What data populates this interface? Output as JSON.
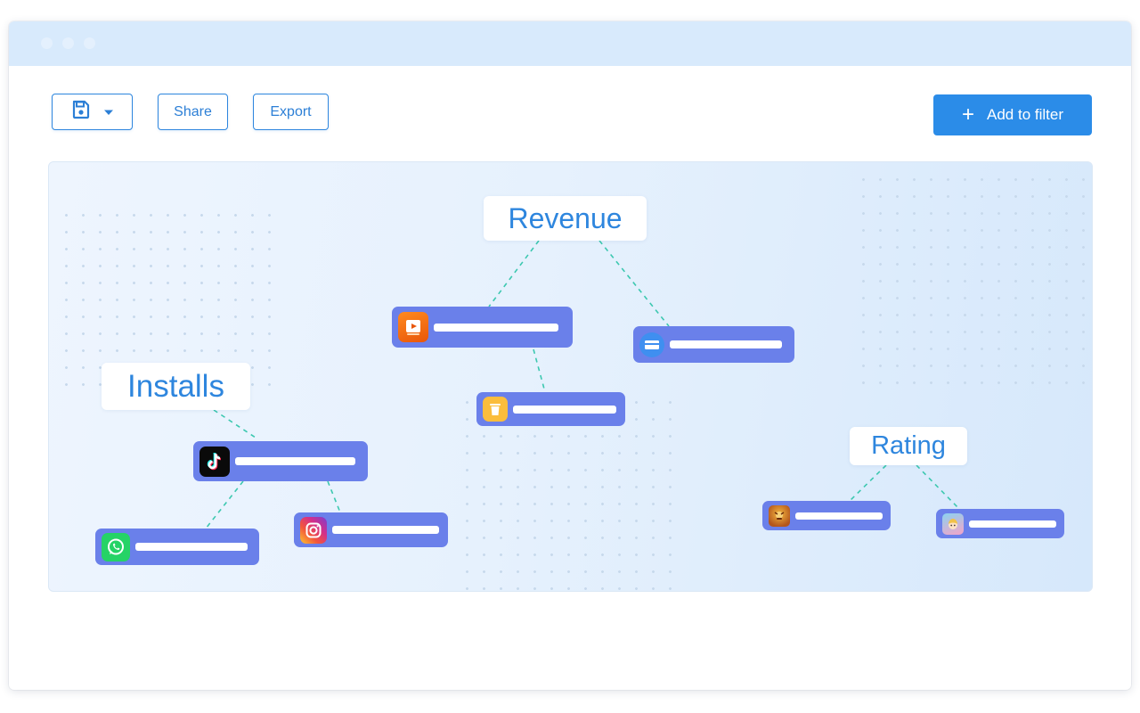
{
  "toolbar": {
    "save_icon": "floppy-disk-icon",
    "dropdown_icon": "caret-down-icon",
    "share_label": "Share",
    "export_label": "Export",
    "add_filter_label": "Add to filter",
    "add_filter_icon": "plus-icon"
  },
  "categories": {
    "revenue": "Revenue",
    "installs": "Installs",
    "rating": "Rating"
  },
  "apps": [
    {
      "icon": "video-recovery-app-icon",
      "category": "revenue"
    },
    {
      "icon": "card-app-icon",
      "category": "revenue"
    },
    {
      "icon": "trash-app-icon",
      "category": "revenue"
    },
    {
      "icon": "tiktok-app-icon",
      "category": "installs"
    },
    {
      "icon": "whatsapp-app-icon",
      "category": "installs"
    },
    {
      "icon": "instagram-app-icon",
      "category": "installs"
    },
    {
      "icon": "clash-game-app-icon",
      "category": "rating"
    },
    {
      "icon": "cartoon-game-app-icon",
      "category": "rating"
    }
  ],
  "colors": {
    "accent": "#2e86de",
    "primary_button": "#2b8ce8",
    "node": "#6a80ea",
    "link": "#3cc8b0",
    "titlebar": "#d8eafc"
  }
}
